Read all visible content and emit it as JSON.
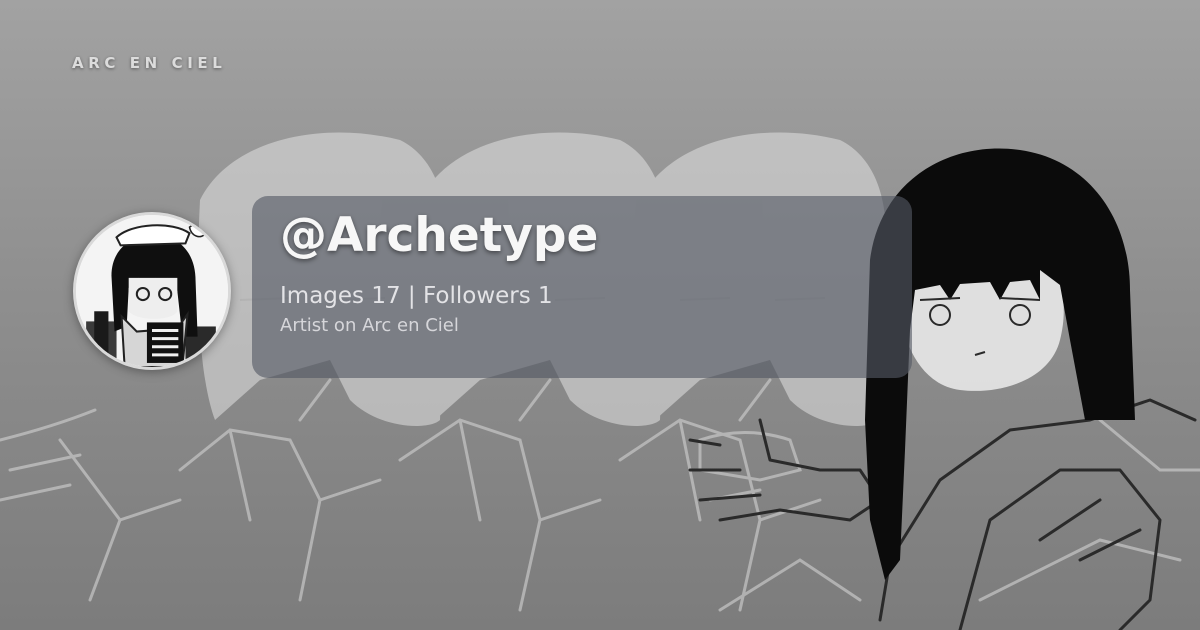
{
  "brand": {
    "name": "ARC EN CIEL"
  },
  "profile": {
    "username": "@Archetype",
    "images_label": "Images",
    "images_count": "17",
    "separator": "|",
    "followers_label": "Followers",
    "followers_count": "1",
    "subtitle": "Artist on Arc en Ciel"
  },
  "colors": {
    "background_top": "#a2a2a2",
    "background_bottom": "#7c7c7c",
    "card": "#545864",
    "text": "#f7f7f7",
    "character_hair": "#0b0b0b"
  },
  "icons": {
    "avatar": "character-avatar-image",
    "background": "character-illustration"
  }
}
